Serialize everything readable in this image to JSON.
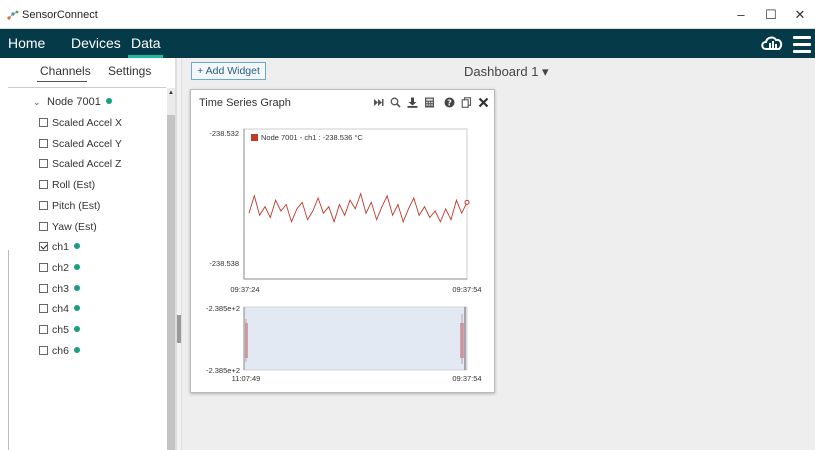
{
  "window": {
    "title": "SensorConnect",
    "controls": [
      "–",
      "☐",
      "✕"
    ]
  },
  "nav": {
    "items": [
      "Home",
      "Devices",
      "Data"
    ],
    "active": "Data"
  },
  "sidebar": {
    "tabs": [
      "Channels",
      "Settings"
    ],
    "active_tab": "Channels",
    "node": {
      "label": "Node 7001",
      "status_color": "#1a9d84"
    },
    "channels": [
      {
        "label": "Scaled Accel X",
        "checked": false,
        "dot": false
      },
      {
        "label": "Scaled Accel Y",
        "checked": false,
        "dot": false
      },
      {
        "label": "Scaled Accel Z",
        "checked": false,
        "dot": false
      },
      {
        "label": "Roll (Est)",
        "checked": false,
        "dot": false
      },
      {
        "label": "Pitch (Est)",
        "checked": false,
        "dot": false
      },
      {
        "label": "Yaw (Est)",
        "checked": false,
        "dot": false
      },
      {
        "label": "ch1",
        "checked": true,
        "dot": true
      },
      {
        "label": "ch2",
        "checked": false,
        "dot": true
      },
      {
        "label": "ch3",
        "checked": false,
        "dot": true
      },
      {
        "label": "ch4",
        "checked": false,
        "dot": true
      },
      {
        "label": "ch5",
        "checked": false,
        "dot": true
      },
      {
        "label": "ch6",
        "checked": false,
        "dot": true
      }
    ]
  },
  "toolbar": {
    "add_widget_label": "+ Add Widget",
    "dashboard_label": "Dashboard 1 ▾"
  },
  "widget": {
    "title": "Time Series Graph",
    "icons": [
      "skip-to-end-icon",
      "zoom-icon",
      "download-icon",
      "calculator-icon",
      "help-icon",
      "copy-icon",
      "close-icon"
    ]
  },
  "chart_data": [
    {
      "type": "line",
      "legend": "Node 7001 - ch1 : -238.536 °C",
      "series_color": "#c0392b",
      "y_tick_labels": [
        "-238.532",
        "-238.538"
      ],
      "x_tick_labels": [
        "09:37:24",
        "09:37:54"
      ],
      "ylim": [
        -238.538,
        -238.532
      ],
      "y": [
        -238.5357,
        -238.5349,
        -238.5358,
        -238.5354,
        -238.5359,
        -238.5351,
        -238.5356,
        -238.5353,
        -238.5361,
        -238.5355,
        -238.5352,
        -238.536,
        -238.5356,
        -238.535,
        -238.5357,
        -238.5354,
        -238.5361,
        -238.5353,
        -238.5358,
        -238.5351,
        -238.5355,
        -238.5348,
        -238.5357,
        -238.5352,
        -238.536,
        -238.5354,
        -238.5349,
        -238.5358,
        -238.5353,
        -238.5361,
        -238.5355,
        -238.535,
        -238.5358,
        -238.5354,
        -238.5359,
        -238.5356,
        -238.5361,
        -238.5355,
        -238.536,
        -238.5351,
        -238.5357,
        -238.5352
      ]
    },
    {
      "type": "area",
      "role": "overview",
      "y_tick_labels": [
        "-2.385e+2",
        "-2.385e+2"
      ],
      "x_tick_labels": [
        "11:07:49",
        "09:37:54"
      ]
    }
  ]
}
